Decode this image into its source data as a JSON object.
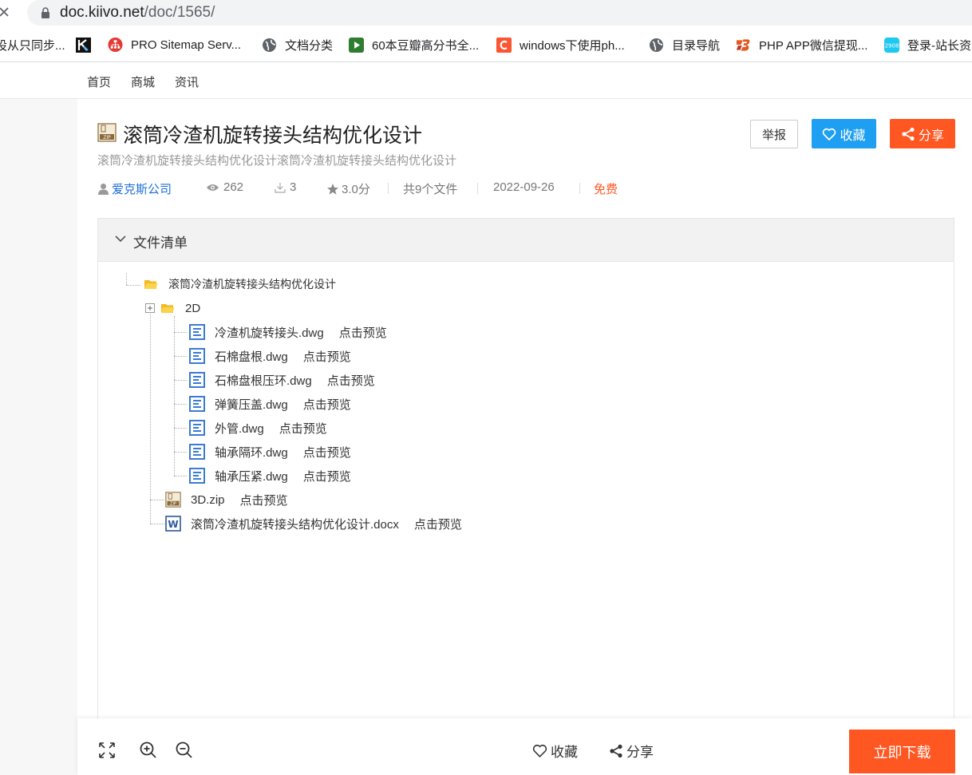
{
  "browser": {
    "url_host": "doc.kiivo.net",
    "url_path": "/doc/1565/"
  },
  "bookmarks": [
    {
      "label": "设从只同步...",
      "icon": "none"
    },
    {
      "label": "",
      "icon": "zhihu-like-icon"
    },
    {
      "label": "PRO Sitemap Serv...",
      "icon": "sitemap-icon"
    },
    {
      "label": "文档分类",
      "icon": "globe-icon"
    },
    {
      "label": "60本豆瓣高分书全...",
      "icon": "play-icon"
    },
    {
      "label": "windows下使用ph...",
      "icon": "c-icon"
    },
    {
      "label": "目录导航",
      "icon": "globe-icon"
    },
    {
      "label": "PHP APP微信提现...",
      "icon": "b-icon"
    },
    {
      "label": "登录-站长资",
      "icon": "2908-icon"
    }
  ],
  "nav": [
    "首页",
    "商城",
    "资讯"
  ],
  "doc": {
    "title": "滚筒冷渣机旋转接头结构优化设计",
    "subtitle": "滚筒冷渣机旋转接头结构优化设计滚筒冷渣机旋转接头结构优化设计",
    "author": "爱克斯公司",
    "views": "262",
    "downloads": "3",
    "score": "3.0分",
    "files": "共9个文件",
    "date": "2022-09-26",
    "price": "免费"
  },
  "actions": {
    "report": "举报",
    "favorite": "收藏",
    "share": "分享"
  },
  "filelist": {
    "title": "文件清单",
    "preview_label": "点击预览",
    "root": "滚筒冷渣机旋转接头结构优化设计",
    "folder_2d": "2D",
    "dwg_files": [
      "冷渣机旋转接头.dwg",
      "石棉盘根.dwg",
      "石棉盘根压环.dwg",
      "弹簧压盖.dwg",
      "外管.dwg",
      "轴承隔环.dwg",
      "轴承压紧.dwg"
    ],
    "zip_file": "3D.zip",
    "docx_file": "滚筒冷渣机旋转接头结构优化设计.docx"
  },
  "bottom": {
    "favorite": "收藏",
    "share": "分享",
    "download": "立即下载"
  },
  "colors": {
    "accent_blue": "#1e9ff2",
    "accent_orange": "#ff5722",
    "link_blue": "#1e6fd9",
    "price_orange": "#ff5722",
    "folder_yellow": "#f7c325"
  }
}
